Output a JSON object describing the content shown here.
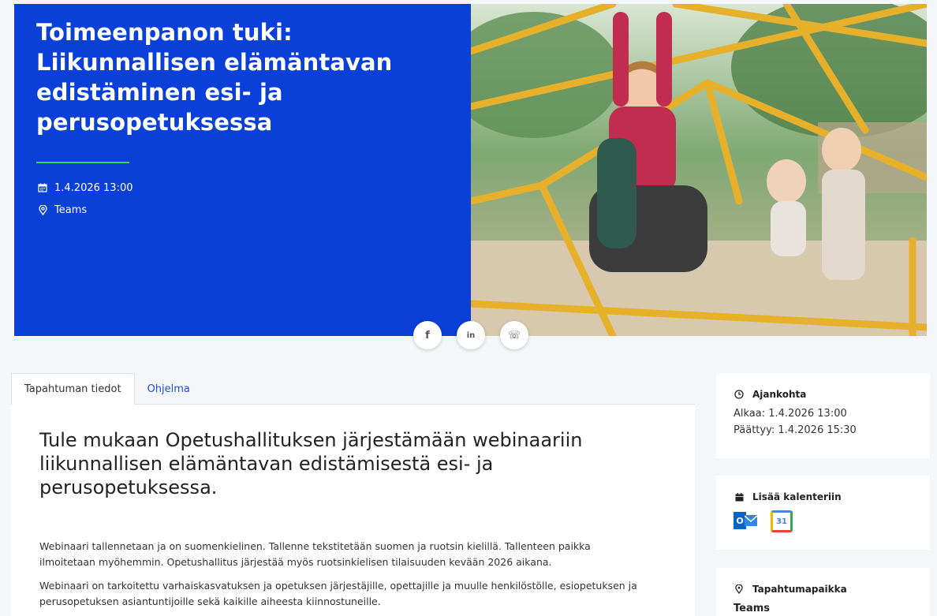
{
  "hero": {
    "title": "Toimeenpanon tuki: Liikunnallisen elämäntavan edistäminen esi- ja perusopetuksessa",
    "date": "1.4.2026 13:00",
    "location": "Teams",
    "accent_color": "#0a3fd8",
    "rule_color": "#3fd05a"
  },
  "share": {
    "facebook_label": "f",
    "linkedin_label": "in",
    "whatsapp_label": "☏"
  },
  "tabs": [
    {
      "label": "Tapahtuman tiedot"
    },
    {
      "label": "Ohjelma"
    }
  ],
  "content": {
    "heading": "Tule mukaan Opetushallituksen järjestämään webinaariin liikunnallisen elämäntavan edistämisestä esi- ja perusopetuksessa.",
    "para1": "Webinaari tallennetaan ja on suomenkielinen. Tallenne tekstitetään suomen ja ruotsin kielillä. Tallenteen paikka ilmoitetaan myöhemmin.  Opetushallitus järjestää myös ruotsinkielisen tilaisuuden kevään 2026 aikana.",
    "para2": "Webinaari on tarkoitettu varhaiskasvatuksen ja opetuksen järjestäjille, opettajille ja muulle henkilöstölle, esiopetuksen ja perusopetuksen asiantuntijoille sekä kaikille aiheesta kiinnostuneille."
  },
  "sidebar": {
    "time": {
      "title": "Ajankohta",
      "start": "Alkaa:  1.4.2026 13:00",
      "end": "Päättyy:  1.4.2026 15:30"
    },
    "calendar": {
      "title": "Lisää kalenteriin",
      "outlook_label": "O",
      "google_label": "31"
    },
    "venue": {
      "title": "Tapahtumapaikka",
      "place": "Teams"
    }
  }
}
